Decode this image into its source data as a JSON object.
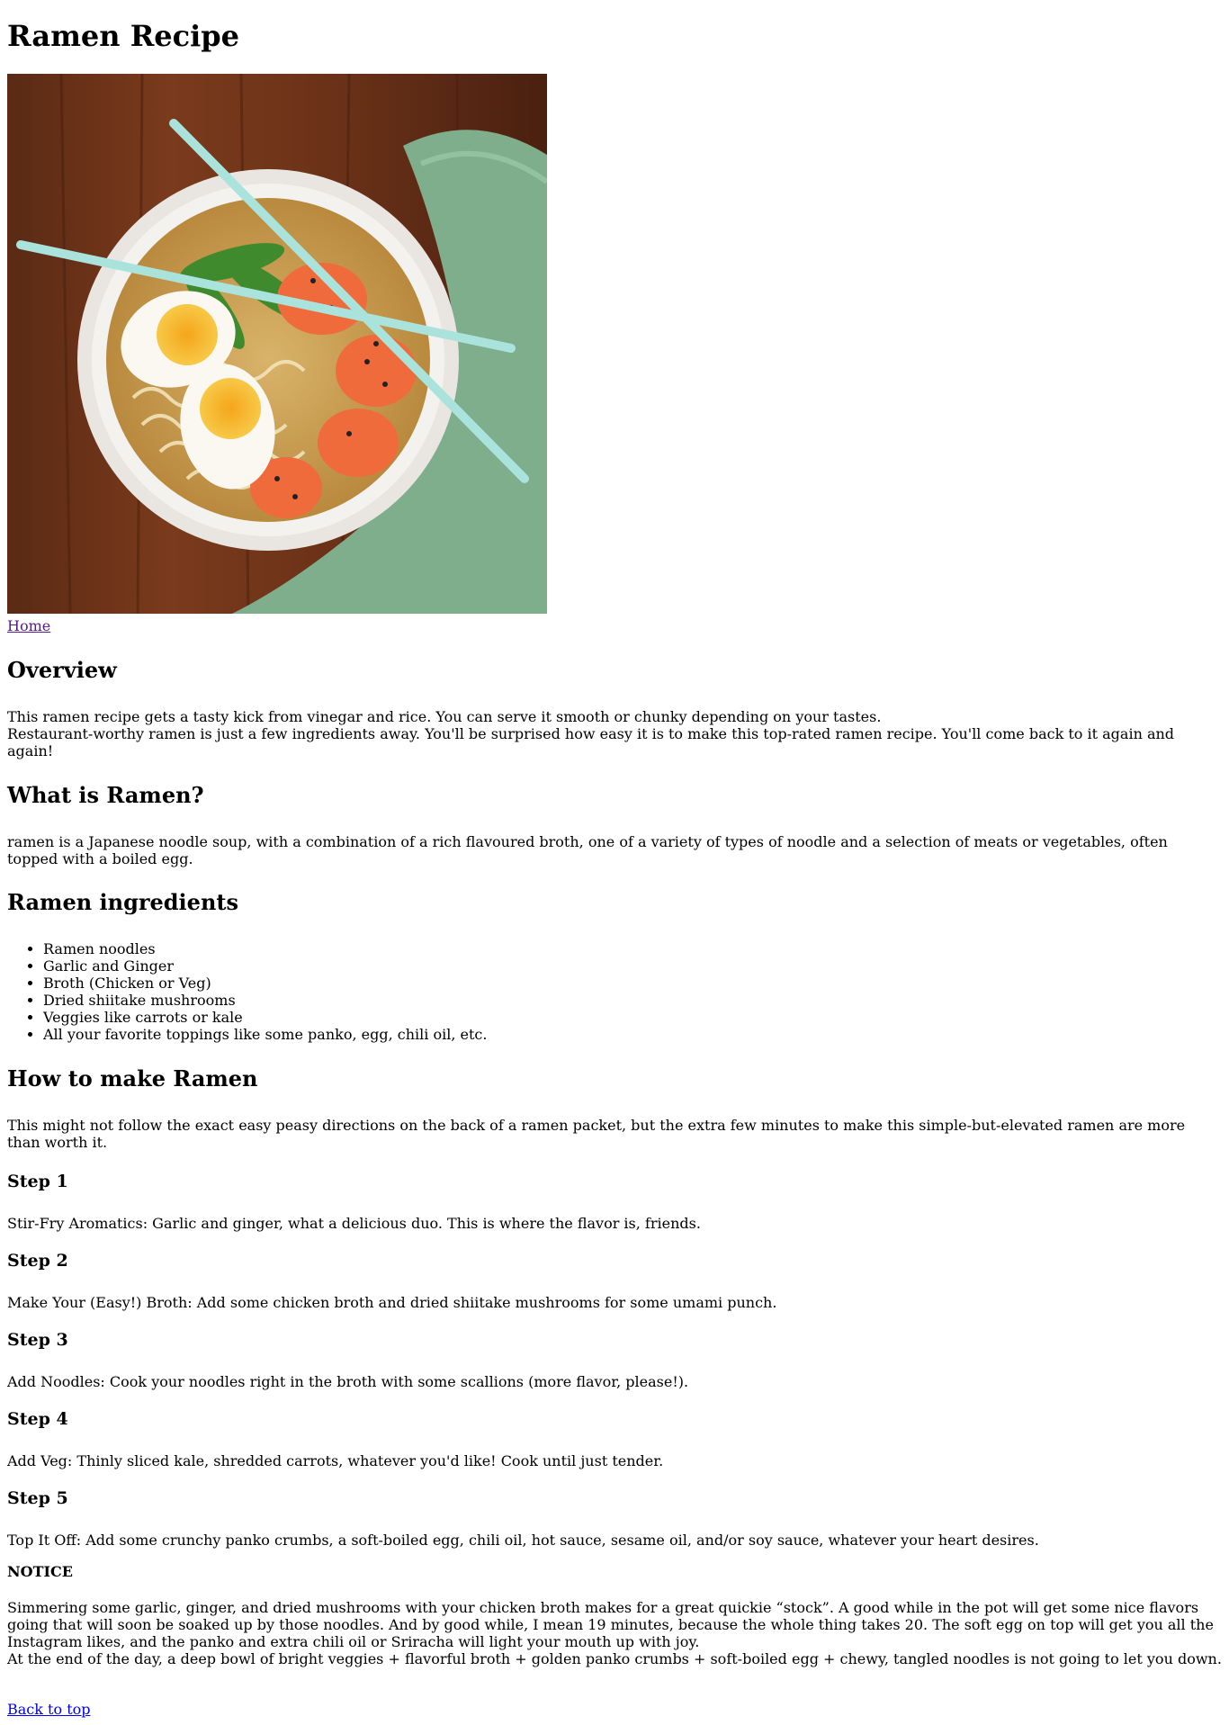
{
  "title": "Ramen Recipe",
  "nav": {
    "home": "Home"
  },
  "overview": {
    "heading": "Overview",
    "p1": "This ramen recipe gets a tasty kick from vinegar and rice. You can serve it smooth or chunky depending on your tastes.",
    "p2": "Restaurant-worthy ramen is just a few ingredients away. You'll be surprised how easy it is to make this top-rated ramen recipe. You'll come back to it again and again!"
  },
  "what": {
    "heading": "What is Ramen?",
    "text": "ramen is a Japanese noodle soup, with a combination of a rich flavoured broth, one of a variety of types of noodle and a selection of meats or vegetables, often topped with a boiled egg."
  },
  "ingredients": {
    "heading": "Ramen ingredients",
    "items": [
      "Ramen noodles",
      "Garlic and Ginger",
      "Broth (Chicken or Veg)",
      "Dried shiitake mushrooms",
      "Veggies like carrots or kale",
      "All your favorite toppings like some panko, egg, chili oil, etc."
    ]
  },
  "how": {
    "heading": "How to make Ramen",
    "intro": "This might not follow the exact easy peasy directions on the back of a ramen packet, but the extra few minutes to make this simple-but-elevated ramen are more than worth it.",
    "steps": [
      {
        "title": "Step 1",
        "text": "Stir-Fry Aromatics: Garlic and ginger, what a delicious duo. This is where the flavor is, friends."
      },
      {
        "title": "Step 2",
        "text": "Make Your (Easy!) Broth: Add some chicken broth and dried shiitake mushrooms for some umami punch."
      },
      {
        "title": "Step 3",
        "text": "Add Noodles: Cook your noodles right in the broth with some scallions (more flavor, please!)."
      },
      {
        "title": "Step 4",
        "text": "Add Veg: Thinly sliced kale, shredded carrots, whatever you'd like! Cook until just tender."
      },
      {
        "title": "Step 5",
        "text": "Top It Off: Add some crunchy panko crumbs, a soft-boiled egg, chili oil, hot sauce, sesame oil, and/or soy sauce, whatever your heart desires."
      }
    ]
  },
  "notice": {
    "heading": "NOTICE",
    "p1": "Simmering some garlic, ginger, and dried mushrooms with your chicken broth makes for a great quickie “stock”. A good while in the pot will get some nice flavors going that will soon be soaked up by those noodles. And by good while, I mean 19 minutes, because the whole thing takes 20. The soft egg on top will get you all the Instagram likes, and the panko and extra chili oil or Sriracha will light your mouth up with joy.",
    "p2": "At the end of the day, a deep bowl of bright veggies + flavorful broth + golden panko crumbs + soft-boiled egg + chewy, tangled noodles is not going to let you down."
  },
  "footer": {
    "back_to_top": "Back to top"
  }
}
